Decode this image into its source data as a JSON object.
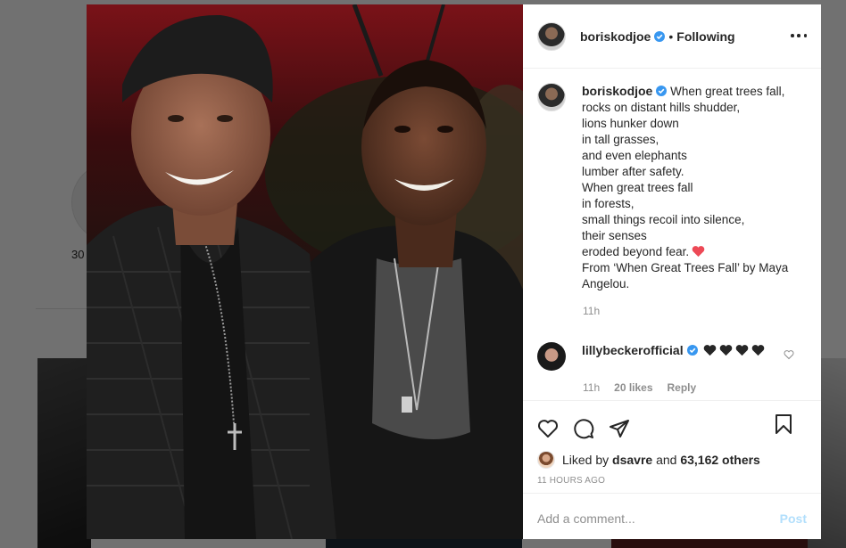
{
  "background": {
    "post_count_fragment": "30"
  },
  "post": {
    "author": "boriskodjoe",
    "follow_status": "Following",
    "dot": "•",
    "caption_lines": [
      "When great trees fall,",
      "rocks on distant hills shudder,",
      "lions hunker down",
      "in tall grasses,",
      "and even elephants",
      "lumber after safety.",
      "When great trees fall",
      "in forests,",
      "small things recoil into silence,",
      "their senses",
      "eroded beyond fear.",
      "From ‘When Great Trees Fall’ by Maya",
      "Angelou."
    ],
    "caption_time": "11h",
    "comment": {
      "user": "lillybeckerofficial",
      "time": "11h",
      "likes": "20 likes",
      "reply_label": "Reply"
    },
    "liked_by_prefix": "Liked by",
    "liked_by_user": "dsavre",
    "liked_by_and": "and",
    "liked_by_others": "63,162 others",
    "timestamp": "11 HOURS AGO",
    "add_comment_placeholder": "Add a comment...",
    "post_button": "Post"
  },
  "colors": {
    "verified": "#3897f0",
    "heart_red": "#ed4956",
    "post_disabled": "#b2dffc"
  },
  "icons": [
    "more-icon",
    "verified-icon",
    "red-heart-icon",
    "black-heart-icon",
    "like-icon",
    "comment-icon",
    "share-icon",
    "save-icon"
  ]
}
